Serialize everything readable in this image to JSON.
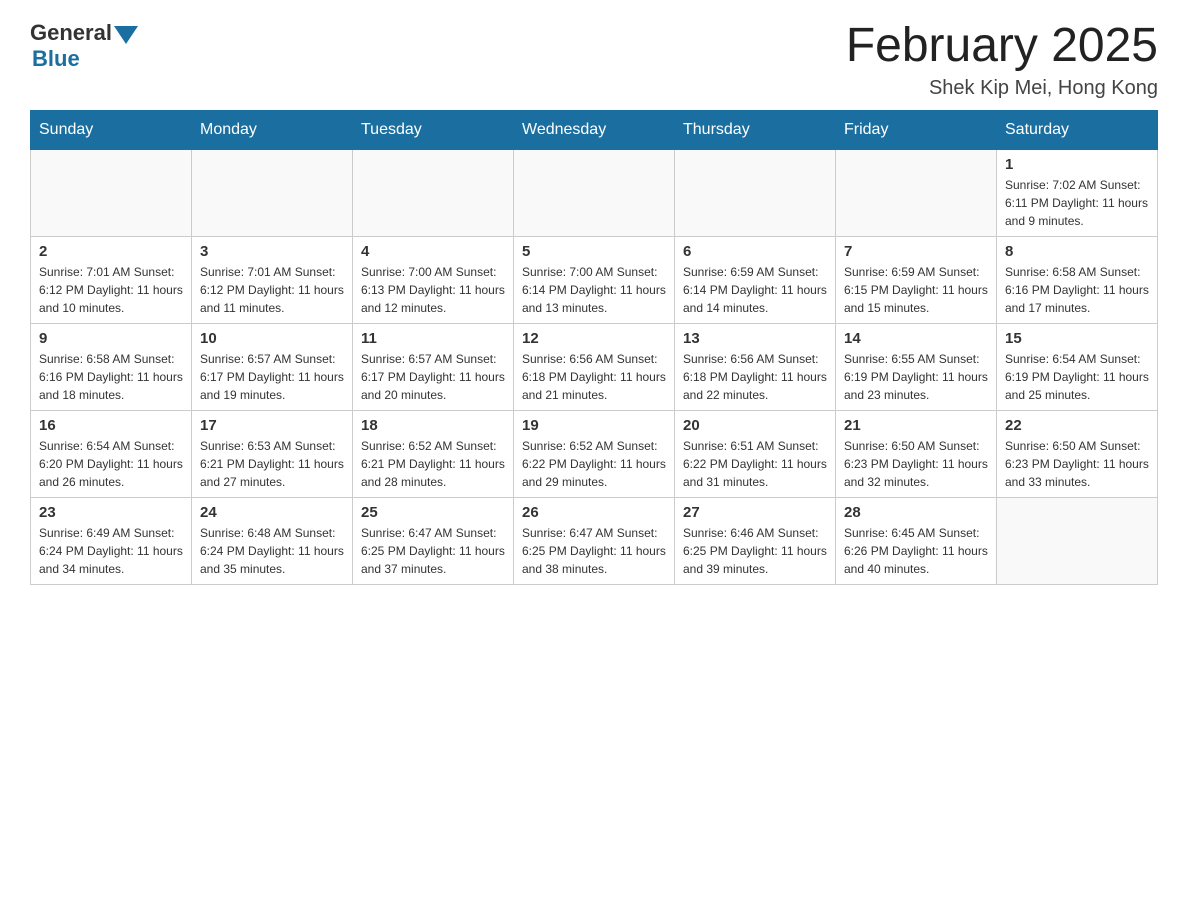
{
  "header": {
    "logo": {
      "general": "General",
      "arrow_color": "#1a6fa0",
      "blue": "Blue"
    },
    "title": "February 2025",
    "location": "Shek Kip Mei, Hong Kong"
  },
  "calendar": {
    "days_of_week": [
      "Sunday",
      "Monday",
      "Tuesday",
      "Wednesday",
      "Thursday",
      "Friday",
      "Saturday"
    ],
    "weeks": [
      [
        {
          "day": "",
          "info": ""
        },
        {
          "day": "",
          "info": ""
        },
        {
          "day": "",
          "info": ""
        },
        {
          "day": "",
          "info": ""
        },
        {
          "day": "",
          "info": ""
        },
        {
          "day": "",
          "info": ""
        },
        {
          "day": "1",
          "info": "Sunrise: 7:02 AM\nSunset: 6:11 PM\nDaylight: 11 hours and 9 minutes."
        }
      ],
      [
        {
          "day": "2",
          "info": "Sunrise: 7:01 AM\nSunset: 6:12 PM\nDaylight: 11 hours and 10 minutes."
        },
        {
          "day": "3",
          "info": "Sunrise: 7:01 AM\nSunset: 6:12 PM\nDaylight: 11 hours and 11 minutes."
        },
        {
          "day": "4",
          "info": "Sunrise: 7:00 AM\nSunset: 6:13 PM\nDaylight: 11 hours and 12 minutes."
        },
        {
          "day": "5",
          "info": "Sunrise: 7:00 AM\nSunset: 6:14 PM\nDaylight: 11 hours and 13 minutes."
        },
        {
          "day": "6",
          "info": "Sunrise: 6:59 AM\nSunset: 6:14 PM\nDaylight: 11 hours and 14 minutes."
        },
        {
          "day": "7",
          "info": "Sunrise: 6:59 AM\nSunset: 6:15 PM\nDaylight: 11 hours and 15 minutes."
        },
        {
          "day": "8",
          "info": "Sunrise: 6:58 AM\nSunset: 6:16 PM\nDaylight: 11 hours and 17 minutes."
        }
      ],
      [
        {
          "day": "9",
          "info": "Sunrise: 6:58 AM\nSunset: 6:16 PM\nDaylight: 11 hours and 18 minutes."
        },
        {
          "day": "10",
          "info": "Sunrise: 6:57 AM\nSunset: 6:17 PM\nDaylight: 11 hours and 19 minutes."
        },
        {
          "day": "11",
          "info": "Sunrise: 6:57 AM\nSunset: 6:17 PM\nDaylight: 11 hours and 20 minutes."
        },
        {
          "day": "12",
          "info": "Sunrise: 6:56 AM\nSunset: 6:18 PM\nDaylight: 11 hours and 21 minutes."
        },
        {
          "day": "13",
          "info": "Sunrise: 6:56 AM\nSunset: 6:18 PM\nDaylight: 11 hours and 22 minutes."
        },
        {
          "day": "14",
          "info": "Sunrise: 6:55 AM\nSunset: 6:19 PM\nDaylight: 11 hours and 23 minutes."
        },
        {
          "day": "15",
          "info": "Sunrise: 6:54 AM\nSunset: 6:19 PM\nDaylight: 11 hours and 25 minutes."
        }
      ],
      [
        {
          "day": "16",
          "info": "Sunrise: 6:54 AM\nSunset: 6:20 PM\nDaylight: 11 hours and 26 minutes."
        },
        {
          "day": "17",
          "info": "Sunrise: 6:53 AM\nSunset: 6:21 PM\nDaylight: 11 hours and 27 minutes."
        },
        {
          "day": "18",
          "info": "Sunrise: 6:52 AM\nSunset: 6:21 PM\nDaylight: 11 hours and 28 minutes."
        },
        {
          "day": "19",
          "info": "Sunrise: 6:52 AM\nSunset: 6:22 PM\nDaylight: 11 hours and 29 minutes."
        },
        {
          "day": "20",
          "info": "Sunrise: 6:51 AM\nSunset: 6:22 PM\nDaylight: 11 hours and 31 minutes."
        },
        {
          "day": "21",
          "info": "Sunrise: 6:50 AM\nSunset: 6:23 PM\nDaylight: 11 hours and 32 minutes."
        },
        {
          "day": "22",
          "info": "Sunrise: 6:50 AM\nSunset: 6:23 PM\nDaylight: 11 hours and 33 minutes."
        }
      ],
      [
        {
          "day": "23",
          "info": "Sunrise: 6:49 AM\nSunset: 6:24 PM\nDaylight: 11 hours and 34 minutes."
        },
        {
          "day": "24",
          "info": "Sunrise: 6:48 AM\nSunset: 6:24 PM\nDaylight: 11 hours and 35 minutes."
        },
        {
          "day": "25",
          "info": "Sunrise: 6:47 AM\nSunset: 6:25 PM\nDaylight: 11 hours and 37 minutes."
        },
        {
          "day": "26",
          "info": "Sunrise: 6:47 AM\nSunset: 6:25 PM\nDaylight: 11 hours and 38 minutes."
        },
        {
          "day": "27",
          "info": "Sunrise: 6:46 AM\nSunset: 6:25 PM\nDaylight: 11 hours and 39 minutes."
        },
        {
          "day": "28",
          "info": "Sunrise: 6:45 AM\nSunset: 6:26 PM\nDaylight: 11 hours and 40 minutes."
        },
        {
          "day": "",
          "info": ""
        }
      ]
    ]
  }
}
